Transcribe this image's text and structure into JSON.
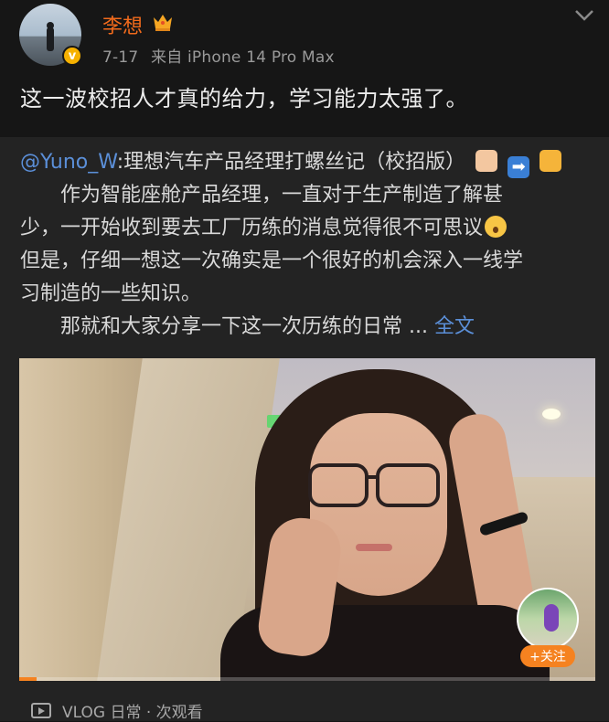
{
  "post": {
    "username": "李想",
    "date": "7-17",
    "source": "来自 iPhone 14 Pro Max",
    "text": "这一波校招人才真的给力，学习能力太强了。"
  },
  "repost": {
    "mention": "@Yuno_W",
    "line1_rest": ":理想汽车产品经理打螺丝记（校招版）",
    "line2": "　　作为智能座舱产品经理，一直对于生产制造了解甚",
    "line3": "少，一开始收到要去工厂历练的消息觉得很不可思议",
    "line4": "但是，仔细一想这一次确实是一个很好的机会深入一线学",
    "line5": "习制造的一些知识。",
    "line6": "　　那就和大家分享一下这一次历练的日常 ... ",
    "expand_link": "全文"
  },
  "video": {
    "progress_percent": 3,
    "follow_label": "+关注",
    "meta": "VLOG 日常 · 次观看"
  },
  "colors": {
    "accent": "#f26b1c",
    "link": "#5b8fd8",
    "progress": "#f58220"
  },
  "icons": [
    "verified-icon",
    "crown-icon",
    "chevron-down-icon",
    "video-icon"
  ]
}
